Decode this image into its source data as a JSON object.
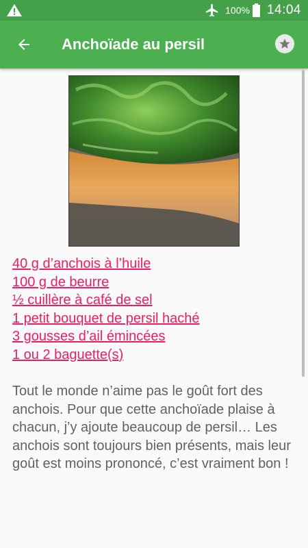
{
  "status_bar": {
    "battery_percent": "100%",
    "time": "14:04",
    "icons": [
      "warning-icon",
      "airplane-mode-icon",
      "battery-full-icon"
    ]
  },
  "app_bar": {
    "title": "Anchoïade au persil",
    "icons": [
      "arrow-back-icon",
      "star-icon"
    ]
  },
  "recipe": {
    "ingredients": [
      "40 g d’anchois à l’huile",
      "100 g de beurre",
      "½ cuillère à café de sel",
      "1 petit bouquet de persil haché",
      "3 gousses d’ail émincées",
      "1 ou 2 baguette(s)"
    ],
    "description": "Tout le monde n’aime pas le goût fort des anchois. Pour que cette anchoïade plaise à chacun, j’y ajoute beaucoup de persil… Les anchois sont toujours bien présents, mais leur goût est moins prononcé, c’est vraiment bon !"
  },
  "colors": {
    "status_bar": "#44a049",
    "app_bar": "#4caf50",
    "link": "#e91e63",
    "body_text": "#616161",
    "background": "#fafafa"
  }
}
